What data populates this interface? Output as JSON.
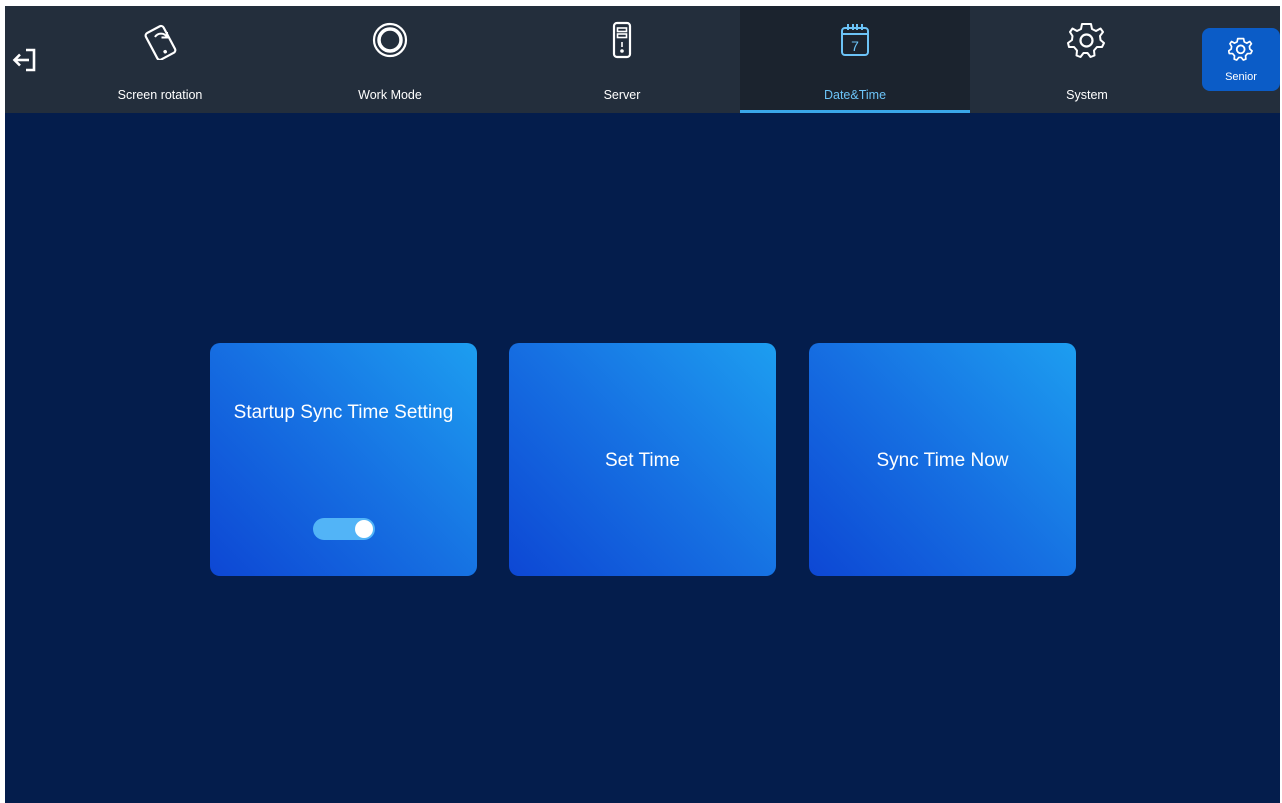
{
  "colors": {
    "background": "#041d4c",
    "topbar": "#232e3c",
    "active_tab": "#1b232e",
    "active_accent": "#3aa7ea",
    "senior_button": "#0b5cc7",
    "card_gradient_start": "#1d9ef0",
    "card_gradient_end": "#0d47d4",
    "toggle_on": "#52b4f7"
  },
  "topbar": {
    "exit_icon": "exit-icon",
    "tabs": [
      {
        "label": "Screen rotation",
        "icon": "phone-rotate-icon",
        "active": false
      },
      {
        "label": "Work Mode",
        "icon": "ring-icon",
        "active": false
      },
      {
        "label": "Server",
        "icon": "server-icon",
        "active": false
      },
      {
        "label": "Date&Time",
        "icon": "calendar-icon",
        "active": true,
        "icon_text": "7"
      },
      {
        "label": "System",
        "icon": "gear-icon",
        "active": false
      }
    ],
    "senior": {
      "label": "Senior",
      "icon": "gear-icon"
    }
  },
  "cards": [
    {
      "title": "Startup Sync Time Setting",
      "toggle": {
        "on": true
      }
    },
    {
      "title": "Set Time"
    },
    {
      "title": "Sync Time Now"
    }
  ]
}
